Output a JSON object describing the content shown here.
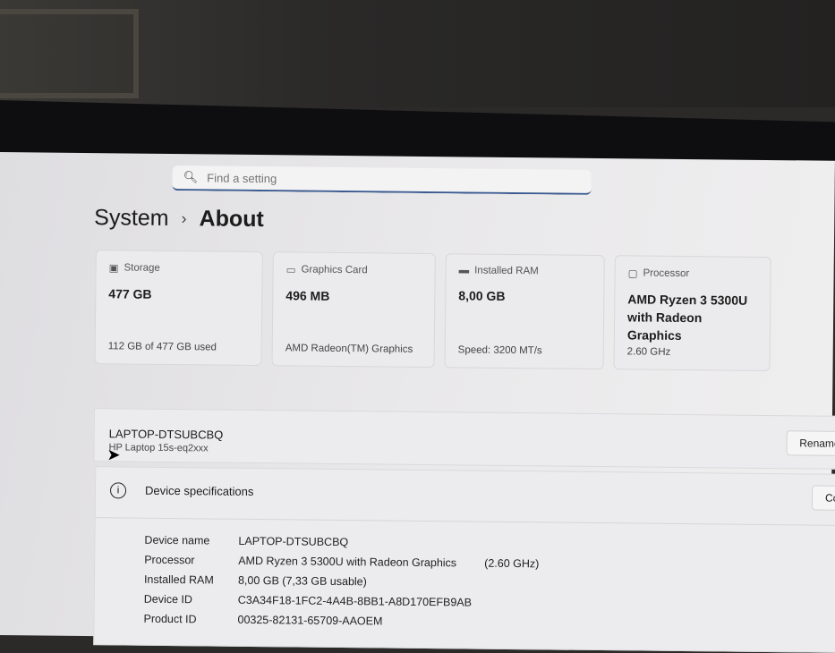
{
  "search": {
    "placeholder": "Find a setting"
  },
  "breadcrumb": {
    "parent": "System",
    "separator": "›",
    "current": "About"
  },
  "cards": [
    {
      "label": "Storage",
      "value": "477 GB",
      "value2": "",
      "sub": "112 GB of 477 GB used"
    },
    {
      "label": "Graphics Card",
      "value": "496 MB",
      "value2": "",
      "sub": "AMD Radeon(TM) Graphics"
    },
    {
      "label": "Installed RAM",
      "value": "8,00 GB",
      "value2": "",
      "sub": "Speed: 3200 MT/s"
    },
    {
      "label": "Processor",
      "value": "AMD Ryzen 3 5300U",
      "value2": "with Radeon Graphics",
      "sub": "2.60 GHz"
    }
  ],
  "device": {
    "name": "LAPTOP-DTSUBCBQ",
    "model": "HP Laptop 15s-eq2xxx",
    "rename": "Rename"
  },
  "specs": {
    "title": "Device specifications",
    "copy": "Copy",
    "rows": [
      {
        "k": "Device name",
        "v": "LAPTOP-DTSUBCBQ",
        "extra": ""
      },
      {
        "k": "Processor",
        "v": "AMD Ryzen 3 5300U with Radeon Graphics",
        "extra": "(2.60 GHz)"
      },
      {
        "k": "Installed RAM",
        "v": "8,00 GB (7,33 GB usable)",
        "extra": ""
      },
      {
        "k": "Device ID",
        "v": "C3A34F18-1FC2-4A4B-8BB1-A8D170EFB9AB",
        "extra": ""
      },
      {
        "k": "Product ID",
        "v": "00325-82131-65709-AAOEM",
        "extra": ""
      }
    ]
  }
}
